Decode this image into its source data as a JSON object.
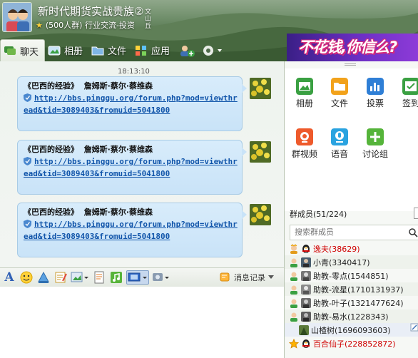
{
  "header": {
    "title": "新时代期货实战贵族②",
    "group_info": "(500人群) 行业交流-投资",
    "vertical_text": "文山丘"
  },
  "ad": {
    "text": "不花钱,你信么?"
  },
  "tabs": [
    {
      "label": "聊天",
      "icon": "chat-icon",
      "active": true
    },
    {
      "label": "相册",
      "icon": "album-icon"
    },
    {
      "label": "文件",
      "icon": "folder-icon"
    },
    {
      "label": "应用",
      "icon": "apps-icon"
    }
  ],
  "chat": {
    "time": "18:13:10",
    "messages": [
      {
        "title": "《巴西的经验》  詹姆斯·蔡尔·蔡维森",
        "link": "http://bbs.pinggu.org/forum.php?mod=viewthread&tid=3089403&fromuid=5041800"
      },
      {
        "title": "《巴西的经验》  詹姆斯·蔡尔·蔡维森",
        "link": "http://bbs.pinggu.org/forum.php?mod=viewthread&tid=3089403&fromuid=5041800"
      },
      {
        "title": "《巴西的经验》  詹姆斯·蔡尔·蔡维森",
        "link": "http://bbs.pinggu.org/forum.php?mod=viewthread&tid=3089403&fromuid=5041800"
      }
    ]
  },
  "input_toolbar": {
    "font_label": "A",
    "record_label": "消息记录"
  },
  "apps": [
    {
      "label": "相册",
      "icon": "album-icon",
      "color": "#3aa042"
    },
    {
      "label": "文件",
      "icon": "folder-icon",
      "color": "#f2a21b"
    },
    {
      "label": "投票",
      "icon": "vote-icon",
      "color": "#2f7fd6"
    },
    {
      "label": "签到",
      "icon": "checkin-icon",
      "color": "#3aa042"
    },
    {
      "label": "群视频",
      "icon": "video-icon",
      "color": "#ee5a2b"
    },
    {
      "label": "语音",
      "icon": "voice-icon",
      "color": "#2aa3e0"
    },
    {
      "label": "讨论组",
      "icon": "discuss-icon",
      "color": "#55b43a"
    }
  ],
  "members": {
    "header": "群成员(51/224)",
    "search_placeholder": "搜索群成员",
    "list": [
      {
        "name": "逸夫(38629)",
        "role": "owner",
        "red": true
      },
      {
        "name": "小青(3340417)",
        "role": "admin"
      },
      {
        "name": "助教-零点(1544851)",
        "role": "admin"
      },
      {
        "name": "助教-流星(1710131937)",
        "role": "admin"
      },
      {
        "name": "助教-叶子(1321477624)",
        "role": "admin"
      },
      {
        "name": "助教-易水(1228343)",
        "role": "admin"
      },
      {
        "name": "山楂树(1696093603)",
        "role": "member"
      },
      {
        "name": "百合仙子(228852872)",
        "role": "star",
        "red": true
      }
    ]
  }
}
